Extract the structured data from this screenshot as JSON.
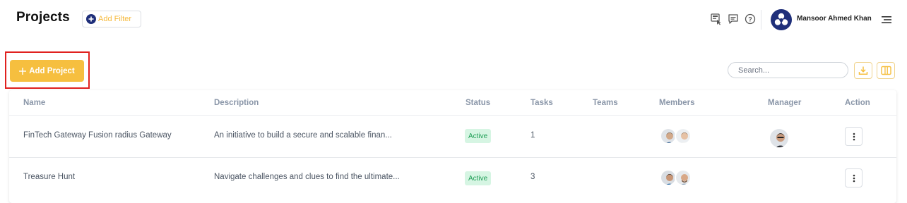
{
  "header": {
    "title": "Projects",
    "add_filter_label": "Add Filter",
    "user_name": "Mansoor Ahmed Khan",
    "icons": [
      "display-notice-icon",
      "chat-icon",
      "help-icon",
      "menu-icon"
    ]
  },
  "toolbar": {
    "add_project_label": "Add Project",
    "search_placeholder": "Search..."
  },
  "table": {
    "columns": [
      "Name",
      "Description",
      "Status",
      "Tasks",
      "Teams",
      "Members",
      "Manager",
      "Action"
    ],
    "rows": [
      {
        "name": "FinTech Gateway Fusion radius Gateway",
        "description": "An initiative to build a secure and scalable finan...",
        "status": "Active",
        "tasks": "1",
        "teams": ""
      },
      {
        "name": "Treasure Hunt",
        "description": "Navigate challenges and clues to find the ultimate...",
        "status": "Active",
        "tasks": "3",
        "teams": ""
      }
    ]
  },
  "colors": {
    "accent": "#f6bf3f",
    "status_bg": "#d6f5e3",
    "status_text": "#1e9e55",
    "brand_navy": "#1f2f7a",
    "highlight": "#e0211f"
  }
}
